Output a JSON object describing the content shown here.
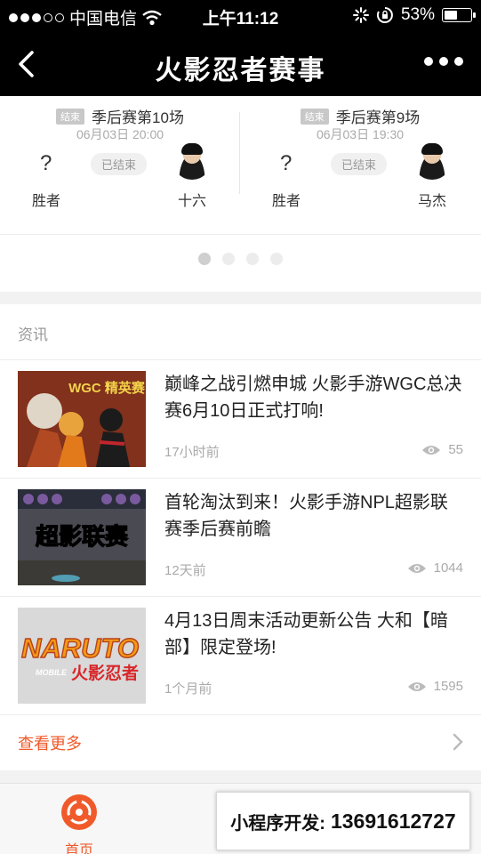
{
  "status_bar": {
    "carrier": "中国电信",
    "time": "上午11:12",
    "battery": "53%",
    "battery_level": 0.53
  },
  "nav": {
    "title": "火影忍者赛事"
  },
  "matches": [
    {
      "tag": "结束",
      "title": "季后赛第10场",
      "time": "06月03日 20:00",
      "left_mark": "?",
      "status": "已结束",
      "left_label": "胜者",
      "right_player": "十六"
    },
    {
      "tag": "结束",
      "title": "季后赛第9场",
      "time": "06月03日 19:30",
      "left_mark": "?",
      "status": "已结束",
      "left_label": "胜者",
      "right_player": "马杰"
    }
  ],
  "news": {
    "header": "资讯",
    "items": [
      {
        "title": "巅峰之战引燃申城 火影手游WGC总决赛6月10日正式打响!",
        "time": "17小时前",
        "views": "55",
        "thumb_text": "WGC 精英赛"
      },
      {
        "title": "首轮淘汰到来！火影手游NPL超影联赛季后赛前瞻",
        "time": "12天前",
        "views": "1044",
        "thumb_text": "超影联赛"
      },
      {
        "title": "4月13日周末活动更新公告 大和【暗部】限定登场!",
        "time": "1个月前",
        "views": "1595",
        "thumb_text": "NARUTO",
        "thumb_sub": "火影忍者",
        "thumb_badge": "MOBILE"
      }
    ],
    "more_label": "查看更多"
  },
  "tabbar": {
    "home_label": "首页"
  },
  "overlay": {
    "label": "小程序开发:",
    "phone": "13691612727"
  },
  "colors": {
    "accent": "#f05a2a",
    "nav_bg": "#000000"
  }
}
